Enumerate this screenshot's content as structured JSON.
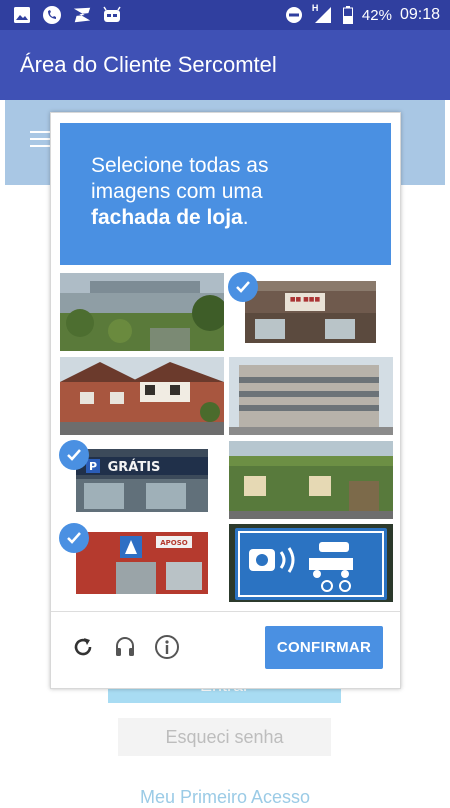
{
  "status_bar": {
    "battery": "42%",
    "time": "09:18",
    "network_label": "H",
    "icons": [
      "image-icon",
      "phone-icon",
      "app-icon",
      "android-icon",
      "dnd-icon",
      "signal-icon",
      "battery-icon"
    ]
  },
  "app_bar": {
    "title": "Área do Cliente Sercomtel"
  },
  "background": {
    "entrar_label": "Entrar",
    "forgot_label": "Esqueci senha",
    "first_access_label": "Meu Primeiro Acesso"
  },
  "captcha": {
    "instruction_line1": "Selecione todas as",
    "instruction_line2": "imagens com uma",
    "instruction_bold": "fachada de loja",
    "instruction_end": ".",
    "tiles": [
      {
        "label": "warehouse-wall",
        "selected": false
      },
      {
        "label": "shop-front",
        "selected": true
      },
      {
        "label": "tudor-house",
        "selected": false
      },
      {
        "label": "office-building",
        "selected": false
      },
      {
        "label": "gratis-store",
        "selected": true
      },
      {
        "label": "green-house",
        "selected": false
      },
      {
        "label": "corner-store",
        "selected": true
      },
      {
        "label": "speed-camera-sign",
        "selected": false
      }
    ],
    "confirm_label": "CONFIRMAR",
    "accent_color": "#4a90e2"
  }
}
